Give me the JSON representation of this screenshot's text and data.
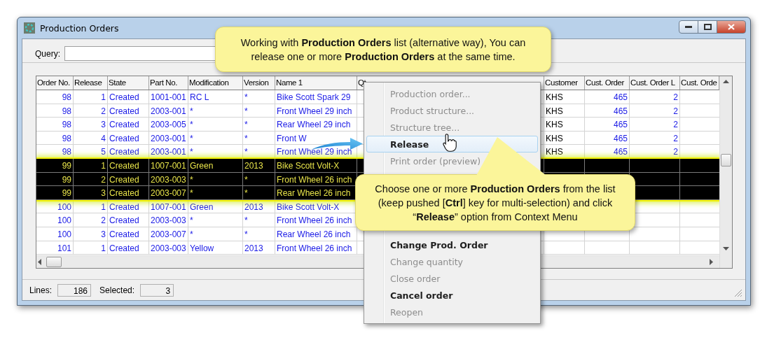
{
  "window": {
    "title": "Production Orders"
  },
  "query": {
    "label": "Query:"
  },
  "table": {
    "columns": [
      {
        "label": "Order No.",
        "kind": "number"
      },
      {
        "label": "Release",
        "kind": "number"
      },
      {
        "label": "State",
        "kind": "text"
      },
      {
        "label": "Part No.",
        "kind": "text"
      },
      {
        "label": "Modification",
        "kind": "text"
      },
      {
        "label": "Version",
        "kind": "text"
      },
      {
        "label": "Name 1",
        "kind": "text"
      },
      {
        "label": "Qt"
      },
      {
        "label": "Customer",
        "kind": "plain"
      },
      {
        "label": "Cust. Order",
        "kind": "number"
      },
      {
        "label": "Cust. Order L",
        "kind": "number"
      },
      {
        "label": "Cust. Orde"
      }
    ],
    "rows": [
      {
        "selected": false,
        "cells": [
          "98",
          "1",
          "Created",
          "1001-001",
          "RC L",
          "*",
          "Bike Scott Spark 29",
          null,
          "KHS",
          "465",
          "2",
          null
        ]
      },
      {
        "selected": false,
        "cells": [
          "98",
          "2",
          "Created",
          "2003-001",
          "*",
          "*",
          "Front Wheel 29 inch",
          null,
          "KHS",
          "465",
          "2",
          null
        ]
      },
      {
        "selected": false,
        "cells": [
          "98",
          "3",
          "Created",
          "2003-005",
          "*",
          "*",
          "Rear Wheel 29 inch",
          null,
          "KHS",
          "465",
          "2",
          null
        ]
      },
      {
        "selected": false,
        "cells": [
          "98",
          "4",
          "Created",
          "2003-001",
          "*",
          "*",
          "Front W",
          null,
          "KHS",
          "465",
          "2",
          null
        ]
      },
      {
        "selected": false,
        "cells": [
          "98",
          "5",
          "Created",
          "2003-001",
          "*",
          "*",
          "Front Wheel 29 inch",
          null,
          "KHS",
          "465",
          "2",
          null
        ]
      },
      {
        "selected": true,
        "cells": [
          "99",
          "1",
          "Created",
          "1007-001",
          "Green",
          "2013",
          "Bike Scott Volt-X",
          null,
          null,
          null,
          null,
          null
        ]
      },
      {
        "selected": true,
        "cells": [
          "99",
          "2",
          "Created",
          "2003-003",
          "*",
          "*",
          "Front Wheel 26 inch",
          null,
          null,
          null,
          null,
          null
        ]
      },
      {
        "selected": true,
        "cells": [
          "99",
          "3",
          "Created",
          "2003-007",
          "*",
          "*",
          "Rear Wheel 26 inch",
          null,
          null,
          null,
          null,
          null
        ]
      },
      {
        "selected": false,
        "cells": [
          "100",
          "1",
          "Created",
          "1007-001",
          "Green",
          "2013",
          "Bike Scott Volt-X",
          null,
          null,
          null,
          null,
          null
        ]
      },
      {
        "selected": false,
        "cells": [
          "100",
          "2",
          "Created",
          "2003-003",
          "*",
          "*",
          "Front Wheel 26 inch",
          null,
          null,
          null,
          null,
          null
        ]
      },
      {
        "selected": false,
        "cells": [
          "100",
          "3",
          "Created",
          "2003-007",
          "*",
          "*",
          "Rear Wheel 26 inch",
          null,
          null,
          null,
          null,
          null
        ]
      },
      {
        "selected": false,
        "cells": [
          "101",
          "1",
          "Created",
          "2003-003",
          "Yellow",
          "2013",
          "Front Wheel 26 inch",
          null,
          null,
          null,
          null,
          null
        ]
      }
    ]
  },
  "status_bar": [
    {
      "label": "Lines:",
      "value": "186"
    },
    {
      "label": "Selected:",
      "value": "3"
    }
  ],
  "context_menu": {
    "items": [
      {
        "label": "Production order...",
        "disabled": true,
        "selected": false
      },
      {
        "label": "Product structure...",
        "disabled": true,
        "selected": false
      },
      {
        "label": "Structure tree...",
        "disabled": true,
        "selected": false
      },
      {
        "label": "Release",
        "disabled": false,
        "selected": true
      },
      {
        "label": "Print order (preview)",
        "disabled": true,
        "selected": false
      },
      {
        "label": "Change Prod. Order",
        "disabled": false,
        "selected": false
      },
      {
        "label": "Change quantity",
        "disabled": true,
        "selected": false
      },
      {
        "label": "Close order",
        "disabled": true,
        "selected": false
      },
      {
        "label": "Cancel order",
        "disabled": false,
        "selected": false
      },
      {
        "label": "Reopen",
        "disabled": true,
        "selected": false
      }
    ]
  },
  "callouts": [
    {
      "text": "Working with **Production Orders** list (alternative way), You can release one or more **Production Orders** at the same time."
    },
    {
      "text": "Choose one or more **Production Orders** from the list (keep pushed [**Ctrl**] key for multi-selection) and click “**Release**” option from Context Menu"
    }
  ]
}
